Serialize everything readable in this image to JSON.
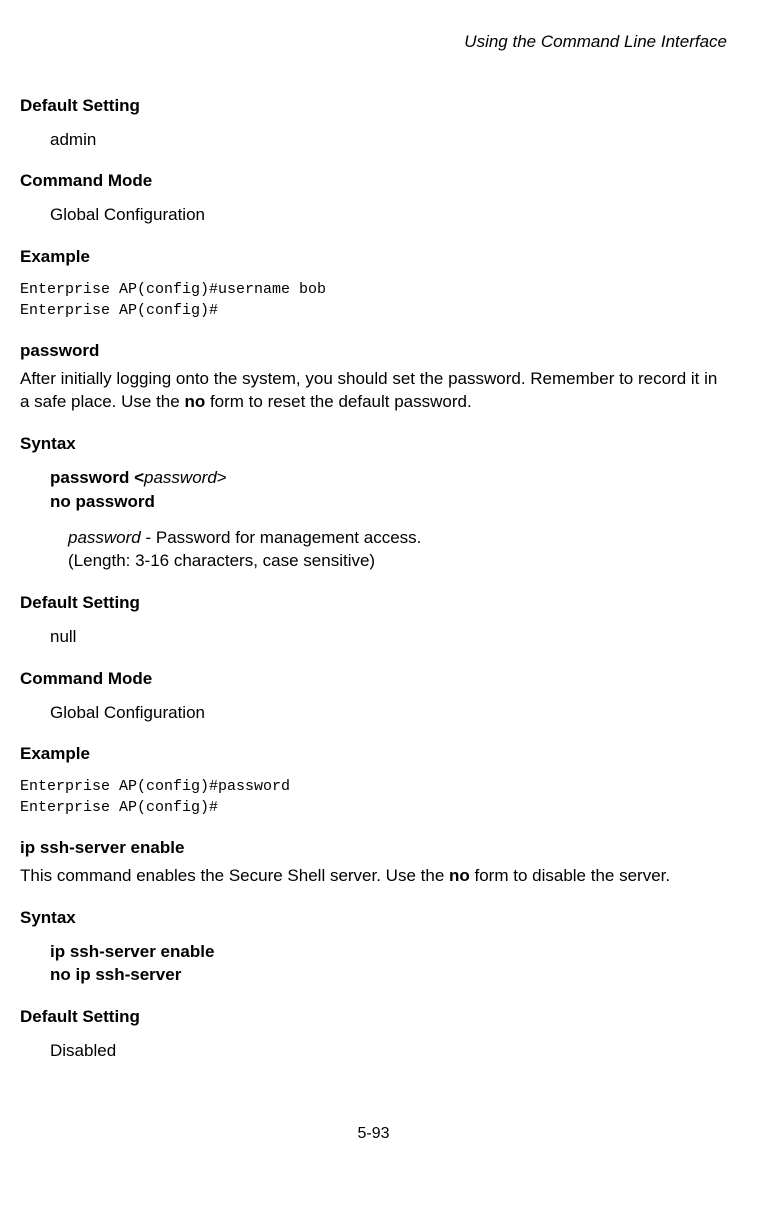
{
  "header": {
    "title": "Using the Command Line Interface"
  },
  "section1": {
    "defaultSettingLabel": "Default Setting",
    "defaultSettingValue": "admin",
    "commandModeLabel": "Command Mode",
    "commandModeValue": "Global Configuration",
    "exampleLabel": "Example",
    "exampleCode": "Enterprise AP(config)#username bob\nEnterprise AP(config)#"
  },
  "section2": {
    "title": "password",
    "desc1": "After initially logging onto the system, you should set the password. Remember to record it in a safe place. Use the ",
    "descBold": "no",
    "desc2": " form to reset the default password.",
    "syntaxLabel": "Syntax",
    "syntaxCmd1a": "password <",
    "syntaxCmd1b": "password",
    "syntaxCmd1c": ">",
    "syntaxCmd2": "no password",
    "paramItalic": "password",
    "paramDash": " - Password for management access.",
    "paramNote": "(Length: 3-16 characters, case sensitive)",
    "defaultSettingLabel": "Default Setting",
    "defaultSettingValue": "null",
    "commandModeLabel": "Command Mode",
    "commandModeValue": "Global Configuration",
    "exampleLabel": "Example",
    "exampleCode": "Enterprise AP(config)#password\nEnterprise AP(config)#"
  },
  "section3": {
    "title": "ip ssh-server enable",
    "desc1": "This command enables the Secure Shell server. Use the ",
    "descBold": "no",
    "desc2": " form to disable the server.",
    "syntaxLabel": "Syntax",
    "syntaxCmd1": "ip ssh-server enable",
    "syntaxCmd2": "no ip ssh-server",
    "defaultSettingLabel": "Default Setting",
    "defaultSettingValue": "Disabled"
  },
  "footer": {
    "pageNumber": "5-93"
  }
}
